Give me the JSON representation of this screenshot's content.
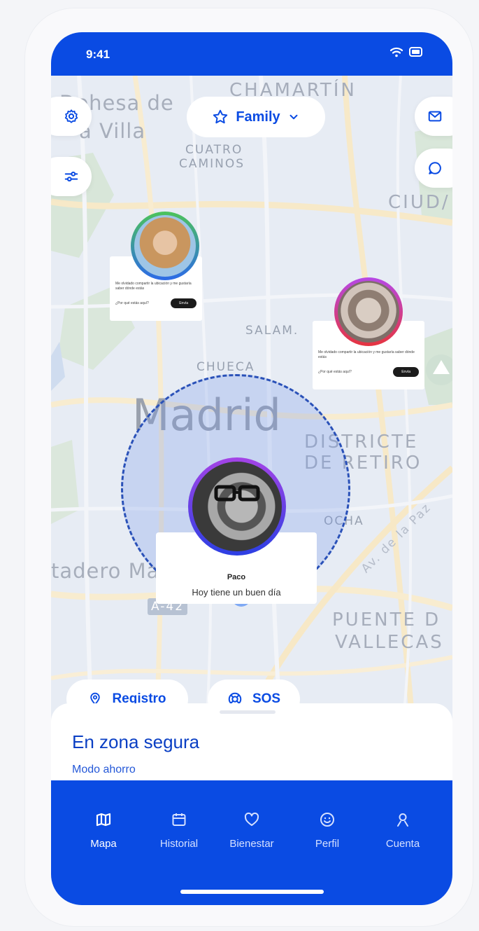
{
  "status_bar": {
    "time": "9:41"
  },
  "map": {
    "labels": {
      "dehesa": "Dehesa de",
      "villa": "a Villa",
      "chamartin": "CHAMARTÍN",
      "cuatro": "CUATRO",
      "caminos": "CAMINOS",
      "ciudad": "CIUD/",
      "salamanca": "SALAM.",
      "chueca": "CHUECA",
      "madrid": "Madrid",
      "districte": "DISTRICTE",
      "deretiro": "DE RETIRO",
      "ocha": "OCHA",
      "avpaz": "Av. de la Paz",
      "matadero": "tadero Madrid",
      "a42": "A-42",
      "puente": "PUENTE D",
      "vallecas": "VALLECAS"
    },
    "group_selector": {
      "label": "Family",
      "icon": "star-icon"
    }
  },
  "member_cards": {
    "woman": {
      "text": "Me olvidado compartir la ubicación y me gustaría saber dónde estás",
      "question": "¿Por qué estás aquí?",
      "button": "Envía"
    },
    "man": {
      "text": "Me olvidado compartir la ubicación y me gustaría saber dónde estás",
      "question": "¿Por qué estás aquí?",
      "button": "Envía"
    },
    "paco": {
      "name": "Paco",
      "status": "Hoy tiene un buen día"
    }
  },
  "actions": {
    "registro": "Registro",
    "sos": "SOS"
  },
  "sheet": {
    "title": "En zona segura",
    "subtitle": "Modo ahorro"
  },
  "nav": [
    {
      "label": "Mapa",
      "icon": "map-icon"
    },
    {
      "label": "Historial",
      "icon": "calendar-icon"
    },
    {
      "label": "Bienestar",
      "icon": "heart-icon"
    },
    {
      "label": "Perfil",
      "icon": "smile-icon"
    },
    {
      "label": "Cuenta",
      "icon": "user-icon"
    }
  ],
  "colors": {
    "primary": "#0a4be3",
    "map_bg": "#e7ecf4",
    "geofence": "#2a51b8"
  }
}
